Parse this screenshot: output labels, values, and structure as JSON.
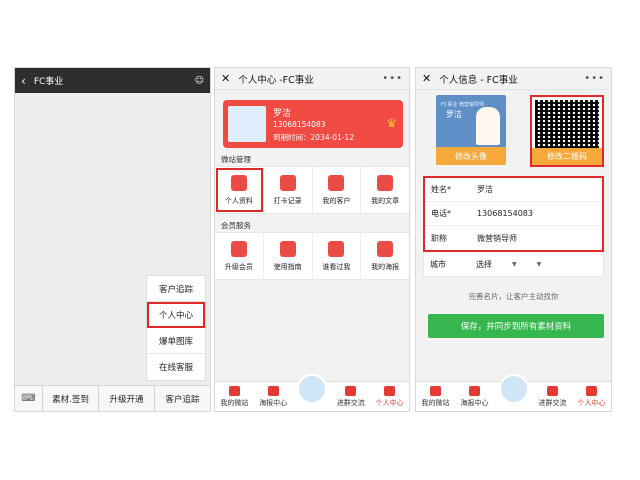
{
  "panel1": {
    "title": "FC事业",
    "popup_items": [
      "客户追踪",
      "个人中心",
      "爆单图库",
      "在线客服"
    ],
    "bottom_menu": [
      "素材.签到",
      "升级开通",
      "客户追踪"
    ]
  },
  "panel2": {
    "title": "个人中心 -FC事业",
    "card": {
      "name": "罗洁",
      "phone": "13068154083",
      "expiry": "到期时间：2034-01-12"
    },
    "section1": "微站管理",
    "grid1": [
      "个人资料",
      "打卡记录",
      "我的客户",
      "我的文章"
    ],
    "section2": "会员服务",
    "grid2": [
      "升级会员",
      "使用指南",
      "谁看过我",
      "我的海报"
    ],
    "tabbar": [
      "我的微站",
      "海报中心",
      "进群交流",
      "个人中心"
    ]
  },
  "panel3": {
    "title": "个人信息 - FC事业",
    "namecard_name": "罗洁",
    "namecard_top": "FC事业 微营销导师",
    "change_avatar": "修改头像",
    "change_qr": "修改二维码",
    "form": [
      {
        "label": "姓名*",
        "value": "罗洁"
      },
      {
        "label": "电话*",
        "value": "13068154083"
      },
      {
        "label": "职称",
        "value": "微营销导师"
      },
      {
        "label": "城市",
        "value": "选择"
      }
    ],
    "hint": "完善名片，让客户主动找你",
    "save": "保存，并同步到所有素材资料",
    "tabbar": [
      "我的微站",
      "海报中心",
      "进群交流",
      "个人中心"
    ]
  },
  "colors": {
    "accent_red": "#e02a2a",
    "card_red": "#f04a43",
    "save_green": "#35b64f",
    "orange": "#f5a93b"
  }
}
